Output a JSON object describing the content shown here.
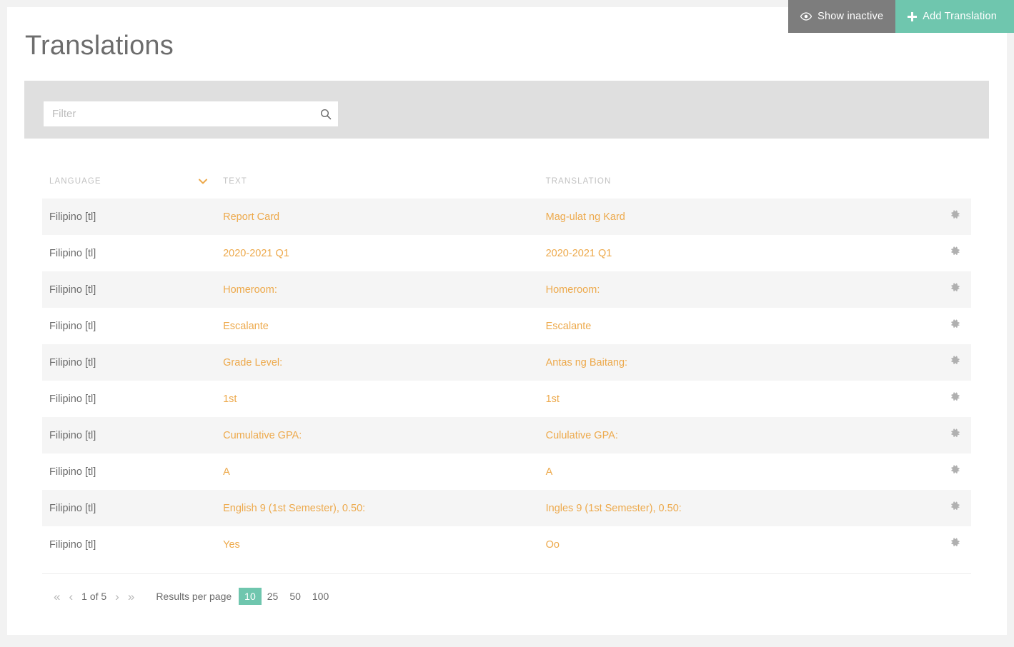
{
  "header": {
    "title": "Translations",
    "buttons": [
      {
        "label": "Show inactive",
        "icon": "eye-icon",
        "color": "#7d7d7d"
      },
      {
        "label": "Add Translation",
        "icon": "plus-icon",
        "color": "#6fc6ae"
      }
    ]
  },
  "filter": {
    "placeholder": "Filter",
    "value": "",
    "search_icon": "search-icon"
  },
  "table": {
    "columns": [
      "LANGUAGE",
      "TEXT",
      "TRANSLATION"
    ],
    "sort_indicator": "⌄",
    "sorted_column": "LANGUAGE",
    "row_action_icon": "gear-icon",
    "rows": [
      {
        "language": "Filipino [tl]",
        "text": "Report Card",
        "translation": "Mag-ulat ng Kard"
      },
      {
        "language": "Filipino [tl]",
        "text": "2020-2021 Q1",
        "translation": "2020-2021 Q1"
      },
      {
        "language": "Filipino [tl]",
        "text": "Homeroom:",
        "translation": "Homeroom:"
      },
      {
        "language": "Filipino [tl]",
        "text": "Escalante",
        "translation": "Escalante"
      },
      {
        "language": "Filipino [tl]",
        "text": "Grade Level:",
        "translation": "Antas ng Baitang:"
      },
      {
        "language": "Filipino [tl]",
        "text": "1st",
        "translation": "1st"
      },
      {
        "language": "Filipino [tl]",
        "text": "Cumulative GPA:",
        "translation": "Cululative GPA:"
      },
      {
        "language": "Filipino [tl]",
        "text": "A",
        "translation": "A"
      },
      {
        "language": "Filipino [tl]",
        "text": "English 9 (1st Semester), 0.50:",
        "translation": "Ingles 9 (1st Semester), 0.50:"
      },
      {
        "language": "Filipino [tl]",
        "text": "Yes",
        "translation": "Oo"
      }
    ]
  },
  "pagination": {
    "first": "«",
    "prev": "‹",
    "page_status": "1 of 5",
    "next": "›",
    "last": "»",
    "results_label": "Results per page",
    "page_sizes": [
      "10",
      "25",
      "50",
      "100"
    ],
    "active_page_size": "10"
  },
  "colors": {
    "accent_green": "#6fc6ae",
    "accent_orange": "#eda94b",
    "inactive_gray": "#7d7d7d",
    "page_background": "#f2f2f2",
    "filter_bar": "#dfdfdf",
    "row_stripe": "#f5f5f5"
  }
}
